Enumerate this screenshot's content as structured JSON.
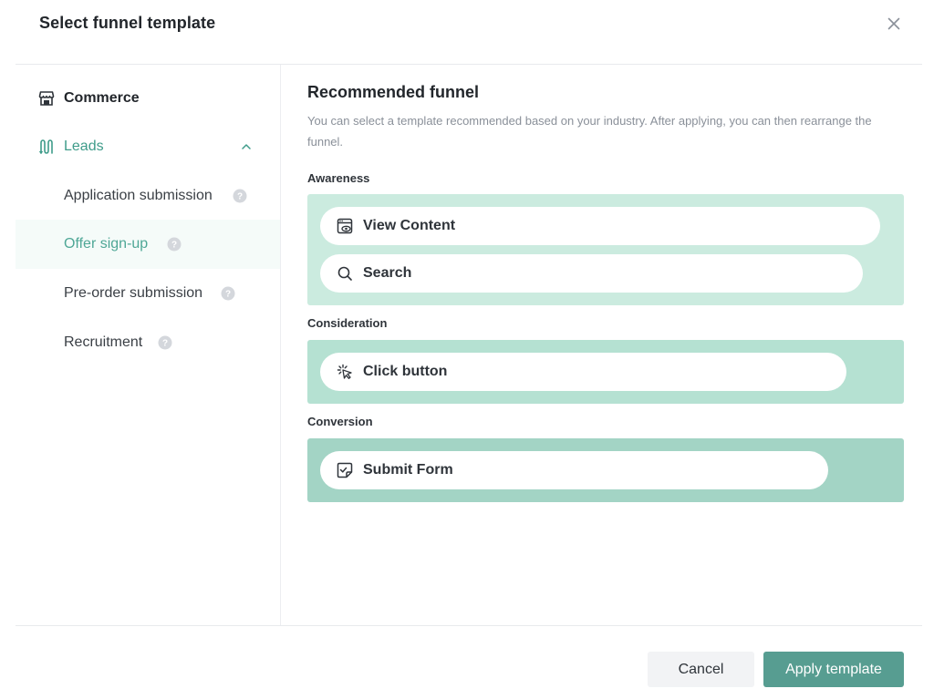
{
  "dialog": {
    "title": "Select funnel template",
    "close_icon": "close-icon"
  },
  "sidebar": {
    "categories": [
      {
        "label": "Commerce",
        "icon": "store-icon"
      },
      {
        "label": "Leads",
        "icon": "funnel-icon",
        "expanded": true
      }
    ],
    "items": [
      {
        "label": "Application submission",
        "icon": "help-icon"
      },
      {
        "label": "Offer sign-up",
        "icon": "help-icon",
        "selected": true
      },
      {
        "label": "Pre-order submission",
        "icon": "help-icon"
      },
      {
        "label": "Recruitment",
        "icon": "help-icon"
      }
    ]
  },
  "main": {
    "title": "Recommended funnel",
    "description": "You can select a template recommended based on your industry. After applying, you can then rearrange the funnel.",
    "stages": [
      {
        "label": "Awareness",
        "color": "#cbebdf",
        "events": [
          {
            "label": "View Content",
            "icon": "view-content-icon"
          },
          {
            "label": "Search",
            "icon": "search-icon"
          }
        ]
      },
      {
        "label": "Consideration",
        "color": "#b5e1d2",
        "events": [
          {
            "label": "Click button",
            "icon": "click-icon"
          }
        ]
      },
      {
        "label": "Conversion",
        "color": "#a3d4c5",
        "events": [
          {
            "label": "Submit Form",
            "icon": "form-icon"
          }
        ]
      }
    ]
  },
  "footer": {
    "cancel_label": "Cancel",
    "apply_label": "Apply template"
  },
  "colors": {
    "accent": "#3f9c8a",
    "primary_button": "#579d91",
    "selected_bg": "#f5fbf9"
  }
}
